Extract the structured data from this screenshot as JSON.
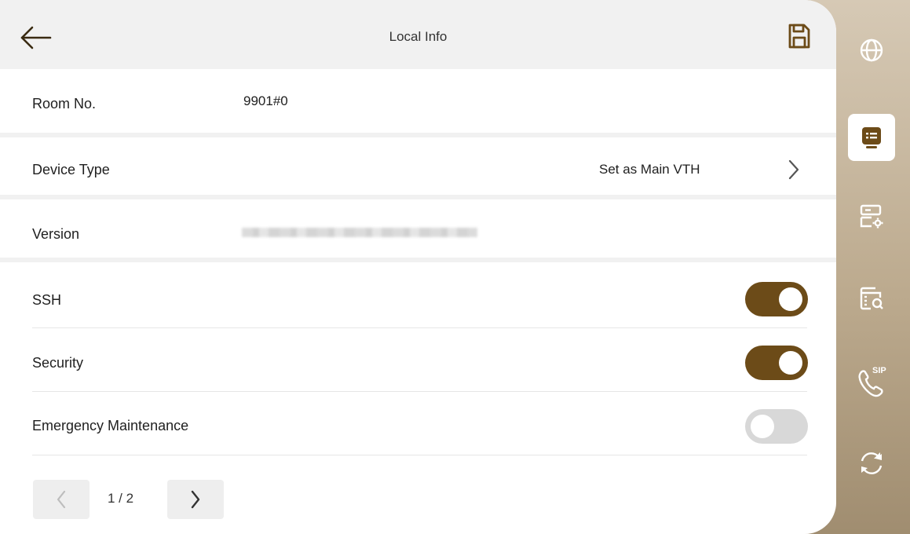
{
  "header": {
    "title": "Local Info"
  },
  "rows": {
    "room_no": {
      "label": "Room No.",
      "value": "9901#0"
    },
    "device_type": {
      "label": "Device Type",
      "value": "Set as Main VTH"
    },
    "version": {
      "label": "Version"
    },
    "ssh": {
      "label": "SSH",
      "enabled": true
    },
    "security": {
      "label": "Security",
      "enabled": true
    },
    "emergency": {
      "label": "Emergency Maintenance",
      "enabled": false
    }
  },
  "pagination": {
    "indicator": "1 / 2"
  },
  "sidebar": {
    "items": [
      {
        "icon": "globe-icon"
      },
      {
        "icon": "local-info-icon",
        "active": true
      },
      {
        "icon": "device-settings-icon"
      },
      {
        "icon": "search-config-icon"
      },
      {
        "icon": "sip-phone-icon",
        "badge": "SIP"
      },
      {
        "icon": "refresh-icon"
      }
    ]
  },
  "colors": {
    "accent": "#6c4b18",
    "toggle_off": "#d8d8d8",
    "header_bg": "#f1f1f1"
  }
}
